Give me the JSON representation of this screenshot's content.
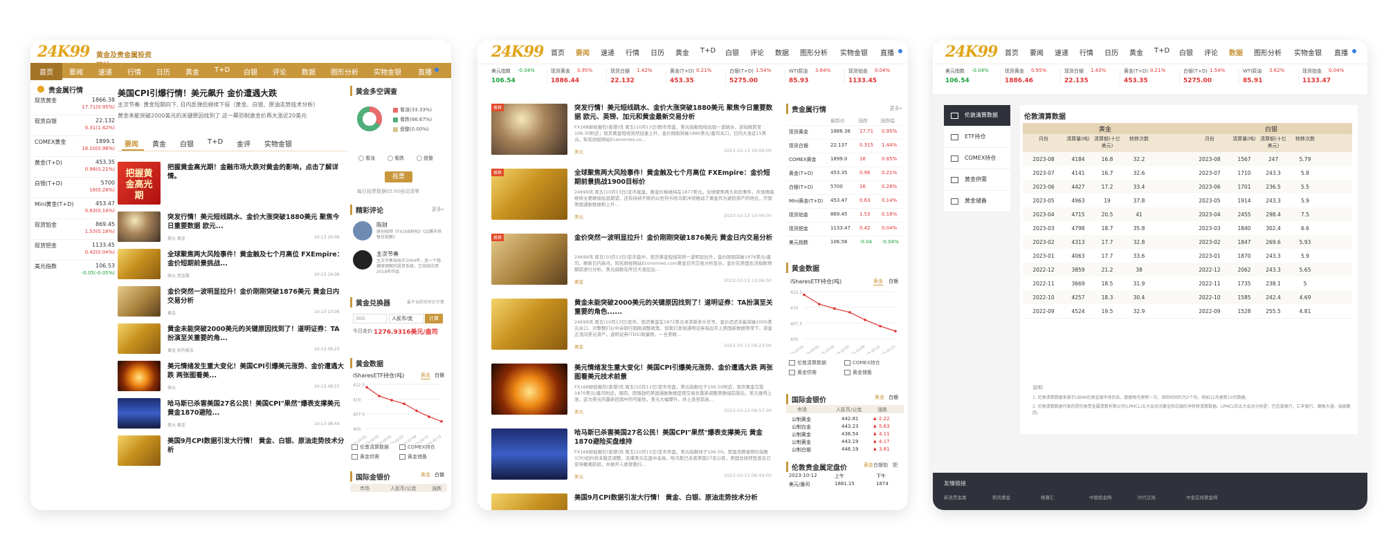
{
  "site": {
    "logo": "24K99",
    "slogan": "黄金及贵金属投资网站"
  },
  "p1": {
    "nav": [
      "首页",
      "要闻",
      "速递",
      "行情",
      "日历",
      "黄金",
      "T+D",
      "白银",
      "评论",
      "数据",
      "图形分析",
      "实物金银",
      "直播"
    ],
    "quotes_title": "贵金属行情",
    "quotes": [
      {
        "name": "现货黄金",
        "value": "1866.38",
        "change": "17.71(0.95%)",
        "dir": "up"
      },
      {
        "name": "现货白银",
        "value": "22.132",
        "change": "0.31(1.42%)",
        "dir": "up"
      },
      {
        "name": "COMEX黄金",
        "value": "1899.1",
        "change": "18.10(0.96%)",
        "dir": "up"
      },
      {
        "name": "黄金(T+D)",
        "value": "453.35",
        "change": "0.96(0.21%)",
        "dir": "up"
      },
      {
        "name": "白银(T+D)",
        "value": "5700",
        "change": "16(0.28%)",
        "dir": "up"
      },
      {
        "name": "Mini黄金(T+D)",
        "value": "453.47",
        "change": "0.63(0.14%)",
        "dir": "up"
      },
      {
        "name": "现货铂金",
        "value": "869.45",
        "change": "1.53(0.18%)",
        "dir": "up"
      },
      {
        "name": "现货钯金",
        "value": "1133.45",
        "change": "0.42(0.04%)",
        "dir": "up"
      },
      {
        "name": "美元指数",
        "value": "106.53",
        "change": "-0.05(-0.05%)",
        "dir": "down"
      }
    ],
    "headline": "美国CPI引爆行情！美元飙升 金价遭遇大跌",
    "headline_sub1": "主次节奏: 黄金短期向下, 日内反弹后继续下探（黄金、白银、原油走势技术分析）",
    "headline_sub2": "黄金未能突破2000美元的关键原因找到了 这一幕恐制激金价再大涨近20美元",
    "tabs": [
      "要闻",
      "黄金",
      "白银",
      "T+D",
      "金评",
      "实物金银"
    ],
    "promo": "把握黄金高光期",
    "news": [
      {
        "title": "把握黄金高光期！金融市场大跌对黄金的影响，点击了解详情。",
        "meta": "",
        "time": ""
      },
      {
        "title": "突发行情！美元短线跳水、金价大涨突破1880美元 聚焦今日重要数据 欧元...",
        "meta": "美元   黄金",
        "time": "10-13 16:06"
      },
      {
        "title": "全球聚焦两大风险事件！黄金触及七个月高位 FXEmpire：金价短期前景挑战...",
        "meta": "美元   资金属",
        "time": "10-13 14:06"
      },
      {
        "title": "金价突然一波明显拉升！金价刚刚突破1876美元 黄金日内交易分析",
        "meta": "黄金",
        "time": "10-13 13:06"
      },
      {
        "title": "黄金未能突破2000美元的关键原因找到了！道明证券：TA扮演至关重要的角...",
        "meta": "黄金   机构报告",
        "time": "10-13 09:23"
      },
      {
        "title": "美元情绪发生重大变化！美国CPI引爆美元涨势、金价遭遇大跌 两张图看美...",
        "meta": "美元",
        "time": "10-13 08:57"
      },
      {
        "title": "哈马斯已杀害美国27名公民！美国CPI\"果然\"爆表支撑美元 黄金1870避险...",
        "meta": "美元   黄金",
        "time": "10-13 08:44"
      },
      {
        "title": "美国9月CPI数据引发大行情！ 黄金、白银、原油走势技术分析",
        "meta": "",
        "time": ""
      }
    ],
    "survey_title": "黄金多空调查",
    "survey": [
      {
        "label": "看涨(33.33%)",
        "value": 33.33,
        "color": "#e86a6a"
      },
      {
        "label": "看跌(66.67%)",
        "value": 66.67,
        "color": "#4fae7a"
      },
      {
        "label": "盘整(0.00%)",
        "value": 0,
        "color": "#d9c48c"
      }
    ],
    "survey_options": [
      "看涨",
      "看跌",
      "盘整"
    ],
    "vote_label": "投票",
    "survey_note": "每日投票数据05:00自动清零",
    "comment_title": "精彩评论",
    "comment_more": "更多»",
    "comments": [
      {
        "name": "陈财",
        "desc": "原创视频《FX168财视》《比赛市场每日观察》"
      },
      {
        "name": "主次节奏",
        "desc": "主次节奏自始于2004年，是一个稳健原理解的投资系统，已持续应用2018年作品"
      }
    ],
    "converter_title": "黄金兑换器",
    "converter_note": "最于当前实时价计算",
    "converter_input": "300",
    "converter_unit": "人民币/克",
    "converter_btn": "计算",
    "converter_result_label": "今日金价:",
    "converter_result": "1276.9316美元/盎司",
    "data_title": "黄金数据",
    "etf_title": "iSharesETF持仓(吨)",
    "etf_tabs": [
      "黄金",
      "白银"
    ],
    "data_links": [
      "伦敦清算数据",
      "COMEX持仓",
      "黄金供需",
      "黄金储备"
    ],
    "intl_title": "国际金银价",
    "intl_tabs": [
      "黄金",
      "白银"
    ],
    "intl_cols": [
      "市场",
      "人民币/公克",
      "涨跌"
    ]
  },
  "ticker": [
    {
      "name": "美元指数",
      "pct": "-0.04%",
      "value": "106.54",
      "dir": "down"
    },
    {
      "name": "现货黄金",
      "pct": "0.95%",
      "value": "1886.44",
      "dir": "up"
    },
    {
      "name": "现货白银",
      "pct": "1.42%",
      "value": "22.132",
      "dir": "up"
    },
    {
      "name": "黄金(T+D)",
      "pct": "0.21%",
      "value": "453.35",
      "dir": "up"
    },
    {
      "name": "白银(T+D)",
      "pct": "1.54%",
      "value": "5275.00",
      "dir": "up"
    },
    {
      "name": "WTI原油",
      "pct": "3.64%",
      "value": "85.93",
      "dir": "up"
    },
    {
      "name": "现货铂金",
      "pct": "0.04%",
      "value": "1133.45",
      "dir": "up"
    }
  ],
  "ticker3": [
    {
      "name": "美元指数",
      "pct": "-0.04%",
      "value": "106.54",
      "dir": "down"
    },
    {
      "name": "现货黄金",
      "pct": "0.95%",
      "value": "1886.46",
      "dir": "up"
    },
    {
      "name": "现货白银",
      "pct": "1.43%",
      "value": "22.135",
      "dir": "up"
    },
    {
      "name": "黄金(T+D)",
      "pct": "0.21%",
      "value": "453.35",
      "dir": "up"
    },
    {
      "name": "白银(T+D)",
      "pct": "1.54%",
      "value": "5275.00",
      "dir": "up"
    },
    {
      "name": "WTI原油",
      "pct": "3.62%",
      "value": "85.91",
      "dir": "up"
    },
    {
      "name": "现货铂金",
      "pct": "0.04%",
      "value": "1133.47",
      "dir": "up"
    }
  ],
  "p2": {
    "nav": [
      "首页",
      "要闻",
      "速递",
      "行情",
      "日历",
      "黄金",
      "T+D",
      "白银",
      "评论",
      "数据",
      "图形分析",
      "实物金银",
      "直播"
    ],
    "news": [
      {
        "tag": "推荐",
        "title": "突发行情！美元短线跳水、金价大涨突破1880美元 聚焦今日重要数据 欧元、英镑、加元和黄金最新交易分析",
        "desc": "FX168财经报社(香港)讯 周五(10月13日)欧市早盘，美元指数短线出现一波跳水，该指数跌至106.30附近；现货黄金短线突然加速上升，金价刚刚突破1880美元/盎司关口，日内大涨近15美元。知名财经网站Economies.co...",
        "meta": "美元",
        "time": "2023-10-13 16:06:00"
      },
      {
        "tag": "推荐",
        "title": "全球聚焦两大风险事件！黄金触及七个月高位 FXEmpire：金价短期前景挑战1900目标价",
        "desc": "24K99讯 周五(10月13日)亚市尾盘，黄金价格维持在1877美元。全球聚焦两大风险事件，市场情绪继续主要联储加息期望，还有持续不断的以色列与哈马斯冲突推动了黄金作为避险资产的地位，尽管美国通胀数据和上升...",
        "meta": "美元",
        "time": "2023-10-13 14:06:00"
      },
      {
        "tag": "推荐",
        "title": "金价突然一波明显拉升！金价刚刚突破1876美元 黄金日内交易分析",
        "desc": "24K99讯 周五(10月13日)亚市盘中，现货黄金短线突然一波明显拉升，金价刚刚突破1876美元/盎司，刷新日内高点。知名财经网站Economies.com黄金日内交易分析显示，金价在美国生活指数预期前进行分析，美元指数在昨日大涨后出...",
        "meta": "黄金",
        "time": "2023-10-13 13:06:00"
      },
      {
        "tag": "",
        "title": "黄金未能突破2000美元的关键原因找到了！道明证券：TA扮演至关重要的角色......",
        "desc": "24K99讯 周五(10月13日)亚市，现货黄金在1872美元寻求新多头信号，金价迟迟未能突破2000美元关口，对整整们以中央银行刚刚调整政策，但我们发现道明证券指出市上美国新数据等增下，资金正流向美元资产。道明证券(TDS)商量称，一旦美联...",
        "meta": "黄金",
        "time": "2023-10-13 09:23:00"
      },
      {
        "tag": "",
        "title": "美元情绪发生重大变化！美国CPI引爆美元涨势、金价遭遇大跌 两张图看美元技术前景",
        "desc": "FX168财经报社(香港)讯 周五(10月13日)亚市早盘，美元指数位于106.50附近，现货黄金交投1870美元/盎司附近。周四，因强劲的美国通胀数据促使交易员重新调整美联储前景后，美元录得上涨，这为美元的最新回落中的可能性，美元大幅攀升，并上涨至前高...",
        "meta": "美元",
        "time": "2023-10-13 08:57:00"
      },
      {
        "tag": "",
        "title": "哈马斯已杀害美国27名公民！美国CPI\"果然\"爆表支撑美元 黄金1870避险买盘维持",
        "desc": "FX168财经报社(香港)讯 周五(10月13日)亚市早盘，美元指数持于106.50。美国消费者物价指数(CPI)如约尚未稳定调整，支撑美元在盘中走高，哈马斯已杀害美国27名公民，美国总统拜登曾在已安排撤离航班，并展开人质营救行...",
        "meta": "美元",
        "time": "2023-10-13 08:44:00"
      },
      {
        "tag": "",
        "title": "美国9月CPI数据引发大行情！ 黄金、白银、原油走势技术分析",
        "desc": "FX168财经报社(北美)讯 周四(10月12日)，根据美国劳工部周四发布的数据显示，美国9月CPI环比上涨0.4%，同比上涨3.7%...",
        "meta": "",
        "time": ""
      }
    ],
    "quotes_title": "贵金属行情",
    "quotes_more": "更多»",
    "quote_cols": [
      "最新价",
      "涨跌",
      "涨跌幅"
    ],
    "quotes": [
      {
        "name": "现货黄金",
        "value": "1886.38",
        "chg": "17.71",
        "pct": "0.95%",
        "dir": "up"
      },
      {
        "name": "现货白银",
        "value": "22.137",
        "chg": "0.315",
        "pct": "1.44%",
        "dir": "up"
      },
      {
        "name": "COMEX黄金",
        "value": "1899.0",
        "chg": "16",
        "pct": "0.85%",
        "dir": "up"
      },
      {
        "name": "黄金(T+D)",
        "value": "453.35",
        "chg": "0.96",
        "pct": "0.21%",
        "dir": "up"
      },
      {
        "name": "白银(T+D)",
        "value": "5700",
        "chg": "16",
        "pct": "0.28%",
        "dir": "up"
      },
      {
        "name": "Mini黄金(T+D)",
        "value": "453.47",
        "chg": "0.63",
        "pct": "0.14%",
        "dir": "up"
      },
      {
        "name": "现货铂金",
        "value": "869.45",
        "chg": "1.53",
        "pct": "0.18%",
        "dir": "up"
      },
      {
        "name": "现货钯金",
        "value": "1133.47",
        "chg": "0.42",
        "pct": "0.04%",
        "dir": "up"
      },
      {
        "name": "美元指数",
        "value": "106.56",
        "chg": "-0.04",
        "pct": "-0.04%",
        "dir": "down"
      }
    ],
    "data_title": "黄金数据",
    "etf_title": "iSharesETF持仓(吨)",
    "etf_tabs": [
      "黄金",
      "白银"
    ],
    "data_links": [
      "伦敦清算数据",
      "COMEX持仓",
      "黄金供需",
      "黄金储备"
    ],
    "intl_title": "国际金银价",
    "intl_tabs": [
      "黄金",
      "白银"
    ],
    "intl_cols": [
      "市场",
      "人民币/公克",
      "涨跌"
    ],
    "intl_rows": [
      {
        "market": "公制黄金",
        "price": "442.81",
        "chg": "2.22"
      },
      {
        "market": "公制白金",
        "price": "443.23",
        "chg": "5.63"
      },
      {
        "market": "公制黄金",
        "price": "436.54",
        "chg": "4.11"
      },
      {
        "market": "公制黄金",
        "price": "443.19",
        "chg": "4.17"
      },
      {
        "market": "公制白银",
        "price": "446.19",
        "chg": "3.81"
      }
    ],
    "london_title": "伦敦贵金属定盘价",
    "london_tabs": [
      "黄金",
      "白银",
      "铂",
      "钯"
    ],
    "london_rows": [
      {
        "date": "2023-10-12",
        "label": "上午",
        "value": "下午"
      },
      {
        "date": "美元/盎司",
        "label": "1881.15",
        "value": "1874"
      }
    ]
  },
  "p3": {
    "nav": [
      "首页",
      "要闻",
      "速递",
      "行情",
      "日历",
      "黄金",
      "T+D",
      "白银",
      "评论",
      "数据",
      "图形分析",
      "实物金银",
      "直播"
    ],
    "side": [
      "伦敦清算数据",
      "ETF持仓",
      "COMEX持仓",
      "黄金供需",
      "黄金储备"
    ],
    "title": "伦敦清算数据",
    "gold_label": "黄金",
    "silver_label": "白银",
    "cols": [
      "月份",
      "清算量(吨)",
      "清算额(十亿美元)",
      "转移次数"
    ],
    "rows": [
      {
        "m": "2023-08",
        "a": "4184",
        "b": "16.8",
        "c": "32.2",
        "m2": "2023-08",
        "a2": "1567",
        "b2": "247",
        "c2": "5.79"
      },
      {
        "m": "2023-07",
        "a": "4141",
        "b": "16.7",
        "c": "32.6",
        "m2": "2023-07",
        "a2": "1710",
        "b2": "243.3",
        "c2": "5.8"
      },
      {
        "m": "2023-06",
        "a": "4427",
        "b": "17.2",
        "c": "33.4",
        "m2": "2023-06",
        "a2": "1701",
        "b2": "236.5",
        "c2": "5.5"
      },
      {
        "m": "2023-05",
        "a": "4963",
        "b": "19",
        "c": "37.8",
        "m2": "2023-05",
        "a2": "1914",
        "b2": "243.3",
        "c2": "5.9"
      },
      {
        "m": "2023-04",
        "a": "4715",
        "b": "20.5",
        "c": "41",
        "m2": "2023-04",
        "a2": "2455",
        "b2": "298.4",
        "c2": "7.5"
      },
      {
        "m": "2023-03",
        "a": "4798",
        "b": "18.7",
        "c": "35.8",
        "m2": "2023-03",
        "a2": "1840",
        "b2": "302.4",
        "c2": "6.6"
      },
      {
        "m": "2023-02",
        "a": "4313",
        "b": "17.7",
        "c": "32.8",
        "m2": "2023-02",
        "a2": "1847",
        "b2": "269.6",
        "c2": "5.93"
      },
      {
        "m": "2023-01",
        "a": "4063",
        "b": "17.7",
        "c": "33.6",
        "m2": "2023-01",
        "a2": "1870",
        "b2": "243.3",
        "c2": "5.9"
      },
      {
        "m": "2022-12",
        "a": "3859",
        "b": "21.2",
        "c": "38",
        "m2": "2022-12",
        "a2": "2062",
        "b2": "243.3",
        "c2": "5.65"
      },
      {
        "m": "2022-11",
        "a": "3669",
        "b": "18.5",
        "c": "31.9",
        "m2": "2022-11",
        "a2": "1735",
        "b2": "238.1",
        "c2": "5"
      },
      {
        "m": "2022-10",
        "a": "4257",
        "b": "18.3",
        "c": "30.4",
        "m2": "2022-10",
        "a2": "1585",
        "b2": "242.4",
        "c2": "4.69"
      },
      {
        "m": "2022-09",
        "a": "4524",
        "b": "19.5",
        "c": "32.9",
        "m2": "2022-09",
        "a2": "1528",
        "b2": "255.5",
        "c2": "4.81"
      }
    ],
    "notes_title": "说明:",
    "note1": "1. 伦敦清算数据来源于LBMA伦敦金银市场协会。数据每月更新一次，滞后时间约为2个月，例如12月更新10月数据。",
    "note2": "2. 伦敦清算数据代表的是伦敦贵金属清算有限公司(LPMCL)五大会员间黄金和白银的净转移清算数据。LPMCL的五大会员分别是：巴克莱银行、汇丰银行、摩根大通、瑞银集团。",
    "footer_title": "友情链接",
    "footer_links": [
      "新浪贵金属",
      "和讯黄金",
      "格隆汇",
      "中国纸金网",
      "时代正扬",
      "中金在线黄金网"
    ]
  },
  "colors": {
    "brand": "#c8973c",
    "up": "#e13131",
    "down": "#18a23a",
    "footer": "#30323b"
  },
  "etf_chart": {
    "type": "line",
    "title": "iSharesETF持仓(吨)",
    "x": [
      "2023-10-01",
      "2023-10-03",
      "2023-10-05",
      "2023-10-07",
      "2023-10-09",
      "2023-10-11",
      "2023-10-13"
    ],
    "y": [
      412,
      410.5,
      409.8,
      409.2,
      408,
      407,
      406.2
    ],
    "ylim": [
      405,
      412.5
    ]
  }
}
